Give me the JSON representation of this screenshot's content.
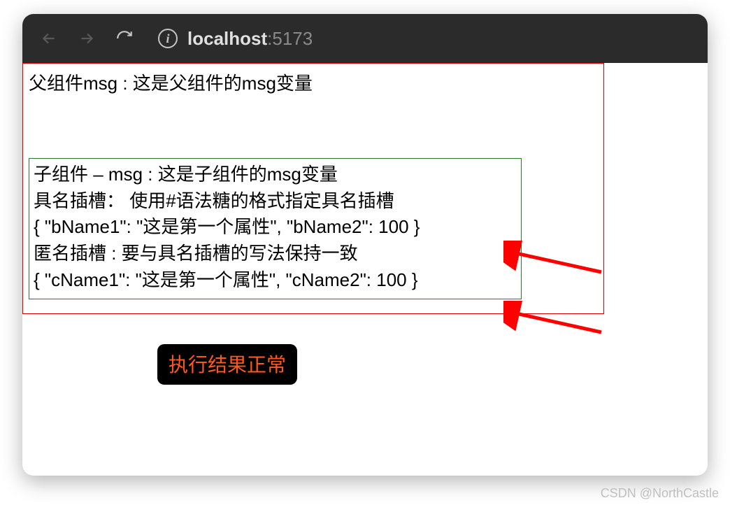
{
  "url": {
    "host": "localhost",
    "port": ":5173"
  },
  "parent": {
    "title": "父组件msg : 这是父组件的msg变量"
  },
  "child": {
    "line1": "子组件 – msg : 这是子组件的msg变量",
    "line2": "具名插槽：  使用#语法糖的格式指定具名插槽",
    "line3": "{ \"bName1\": \"这是第一个属性\", \"bName2\": 100 }",
    "line4": "匿名插槽 : 要与具名插槽的写法保持一致",
    "line5": "{ \"cName1\": \"这是第一个属性\", \"cName2\": 100 }"
  },
  "badge": {
    "text": "执行结果正常"
  },
  "watermark": "CSDN @NorthCastle"
}
